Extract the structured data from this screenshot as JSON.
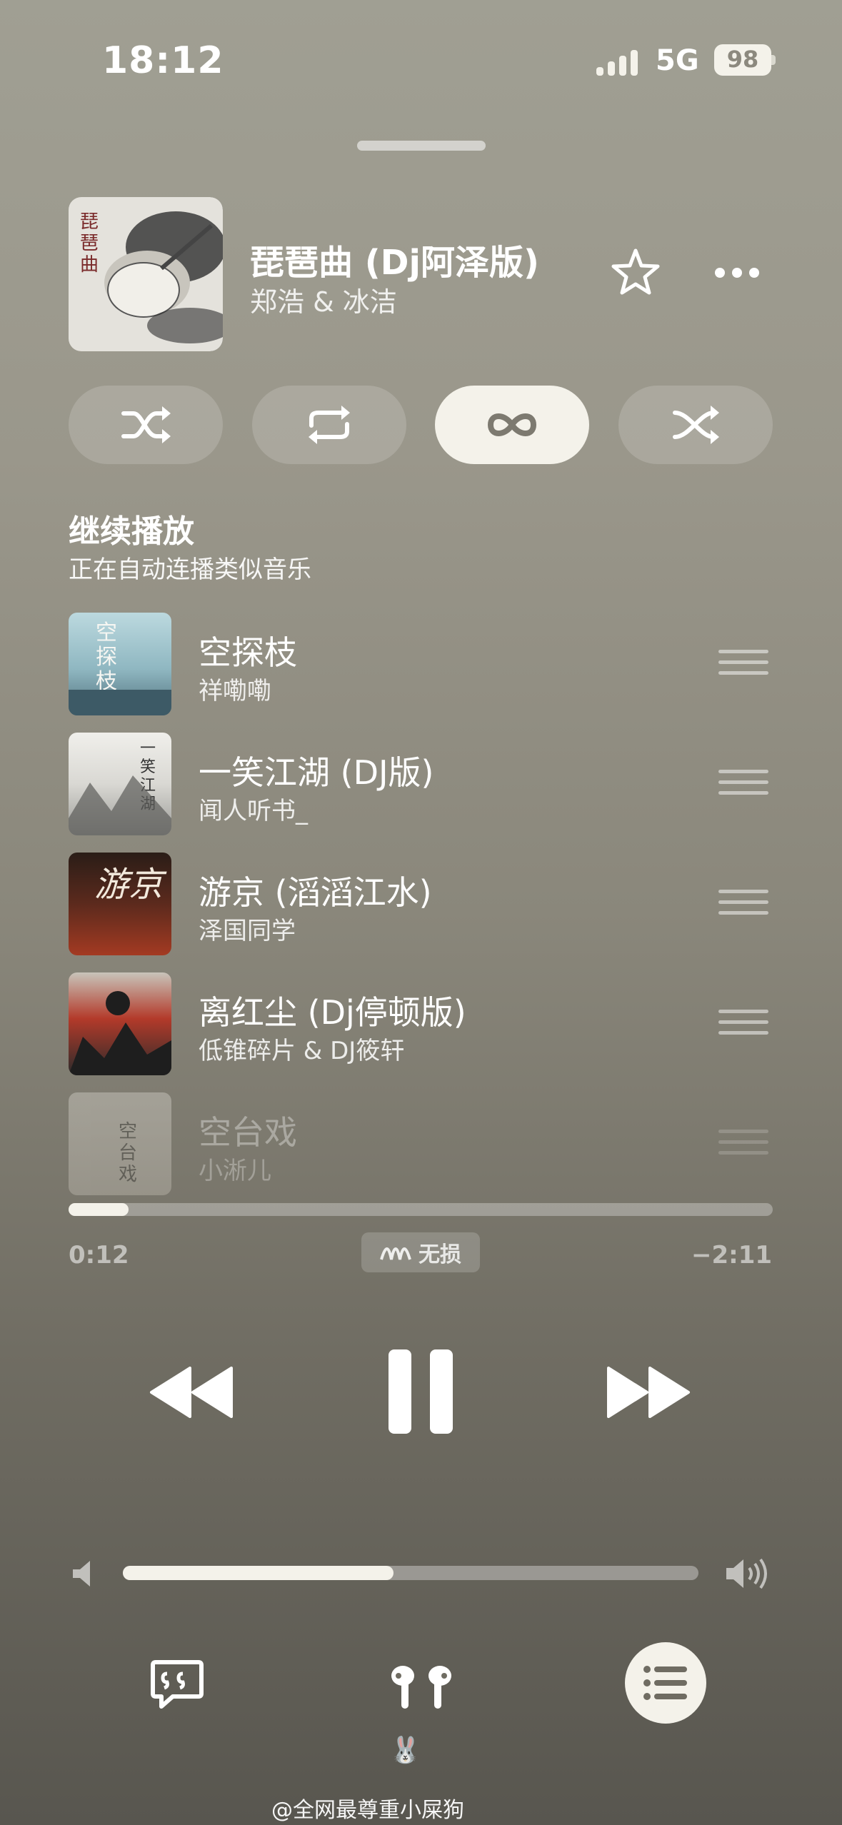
{
  "status_bar": {
    "time": "18:12",
    "network": "5G",
    "battery": "98"
  },
  "now_playing": {
    "title": "琵琶曲 (Dj阿泽版)",
    "artist": "郑浩 & 冰洁",
    "cover_text": "琵琶曲"
  },
  "up_next": {
    "title": "继续播放",
    "subtitle": "正在自动连播类似音乐",
    "items": [
      {
        "title": "空探枝",
        "artist": "祥嘞嘞",
        "cover_text": "空探枝"
      },
      {
        "title": "一笑江湖 (DJ版)",
        "artist": "闻人听书_",
        "cover_text": "一笑江湖"
      },
      {
        "title": "游京 (滔滔江水)",
        "artist": "泽国同学",
        "cover_text": "游京"
      },
      {
        "title": "离红尘 (Dj停顿版)",
        "artist": "低锥碎片 & DJ筱轩",
        "cover_text": ""
      },
      {
        "title": "空台戏",
        "artist": "小淅儿",
        "cover_text": "空台戏"
      }
    ]
  },
  "playback": {
    "elapsed": "0:12",
    "remaining": "−2:11",
    "progress_fraction": 0.085,
    "quality_label": "无损",
    "volume_fraction": 0.47
  },
  "bottom": {
    "device_label": "🐰"
  },
  "watermark": "@全网最尊重小屎狗",
  "colors": {
    "accent": "#f4f2ea",
    "background_top": "#a09f93",
    "background_bottom": "#58564f"
  }
}
